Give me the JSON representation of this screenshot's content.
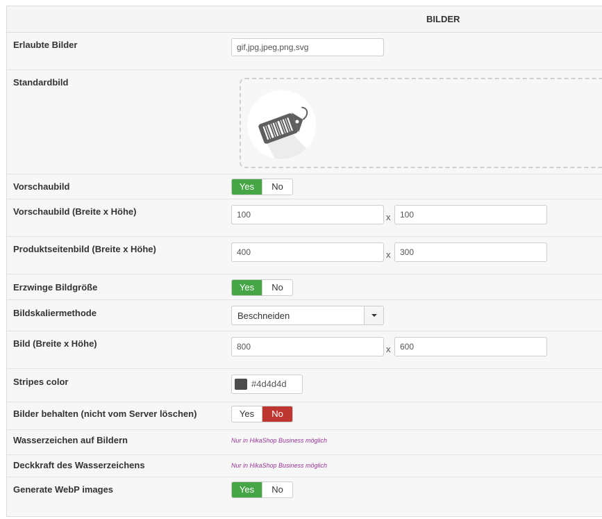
{
  "section_title": "BILDER",
  "rows": {
    "allowed": {
      "label": "Erlaubte Bilder",
      "value": "gif,jpg,jpeg,png,svg"
    },
    "default_image": {
      "label": "Standardbild"
    },
    "thumbnail": {
      "label": "Vorschaubild",
      "yes": "Yes",
      "no": "No",
      "selected": "Yes"
    },
    "thumbnail_size": {
      "label": "Vorschaubild (Breite x Höhe)",
      "width": "100",
      "height": "100",
      "sep": "x"
    },
    "product_page_size": {
      "label": "Produktseitenbild (Breite x Höhe)",
      "width": "400",
      "height": "300",
      "sep": "x"
    },
    "force_size": {
      "label": "Erzwinge Bildgröße",
      "yes": "Yes",
      "no": "No",
      "selected": "Yes"
    },
    "scale_method": {
      "label": "Bildskaliermethode",
      "value": "Beschneiden"
    },
    "image_size": {
      "label": "Bild (Breite x Höhe)",
      "width": "800",
      "height": "600",
      "sep": "x"
    },
    "stripes_color": {
      "label": "Stripes color",
      "value": "#4d4d4d"
    },
    "keep_images": {
      "label": "Bilder behalten (nicht vom Server löschen)",
      "yes": "Yes",
      "no": "No",
      "selected": "No"
    },
    "watermark": {
      "label": "Wasserzeichen auf Bildern",
      "note": "Nur in HikaShop Business möglich"
    },
    "watermark_opacity": {
      "label": "Deckkraft des Wasserzeichens",
      "note": "Nur in HikaShop Business möglich"
    },
    "webp": {
      "label": "Generate WebP images",
      "yes": "Yes",
      "no": "No",
      "selected": "Yes"
    }
  },
  "colors": {
    "yes_active": "#46a546",
    "no_active": "#bd362f",
    "note": "#993399"
  },
  "icons": {
    "default_image": "price-tag-icon",
    "dropdown": "caret-down-icon"
  }
}
